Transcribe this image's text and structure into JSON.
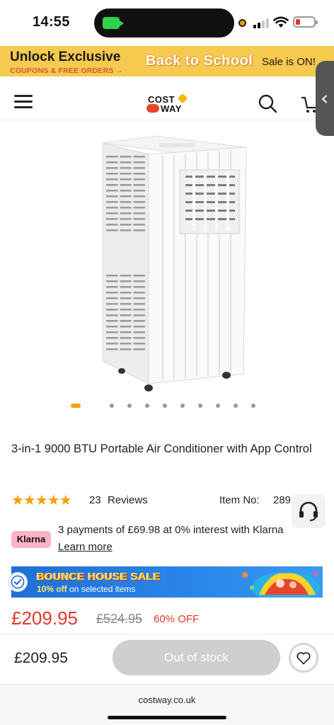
{
  "status_bar": {
    "time": "14:55"
  },
  "promo": {
    "title": "Unlock Exclusive",
    "subtitle": "COUPONS & FREE ORDERS →",
    "campaign": "Back to School",
    "sale_text": "Sale is ON!"
  },
  "header": {
    "logo_top": "COST",
    "logo_bottom": "WAY"
  },
  "carousel": {
    "slide_count": 11,
    "active_index": 0
  },
  "product": {
    "title": "3-in-1 9000 BTU Portable Air Conditioner with App Control",
    "rating_stars": "★★★★★",
    "rating": 5,
    "review_count": "23",
    "reviews_label": "Reviews",
    "item_no_label": "Item No:",
    "item_no_value": "289"
  },
  "klarna": {
    "badge": "Klarna",
    "text": "3 payments of £69.98 at 0% interest with Klarna",
    "link": "Learn more"
  },
  "bounce_banner": {
    "title": "BOUNCE HOUSE SALE",
    "discount": "10% off",
    "subtitle": "on selected items"
  },
  "pricing": {
    "price": "£209.95",
    "original_price": "£524.95",
    "discount": "60% OFF"
  },
  "bottom_bar": {
    "price": "£209.95",
    "button_label": "Out of stock"
  },
  "browser": {
    "url": "costway.co.uk"
  },
  "colors": {
    "promo_bg": "#f6c94f",
    "price_red": "#e0392b",
    "star_orange": "#f5a000",
    "klarna_pink": "#ffb3c7",
    "banner_blue": "#1f6fd6"
  }
}
